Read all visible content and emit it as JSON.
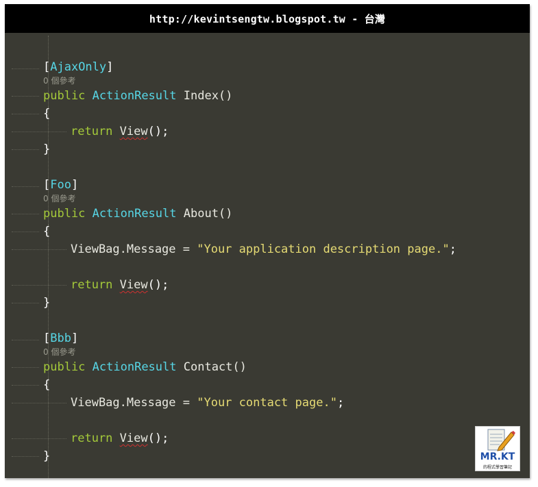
{
  "banner": {
    "text": "http://kevintsengtw.blogspot.tw - 台灣"
  },
  "code": {
    "ref_label": "0 個參考",
    "a1": {
      "open": "[",
      "name": "AjaxOnly",
      "close": "]"
    },
    "m1": {
      "kw": "public",
      "type": "ActionResult",
      "name": "Index()"
    },
    "brace_open": "{",
    "brace_close": "}",
    "ret": {
      "kw": "return",
      "call": "View",
      "tail": "();"
    },
    "a2": {
      "open": "[",
      "name": "Foo",
      "close": "]"
    },
    "m2": {
      "kw": "public",
      "type": "ActionResult",
      "name": "About()"
    },
    "msg_prefix": "ViewBag.Message = ",
    "str_about": "\"Your application description page.\"",
    "semi": ";",
    "a3": {
      "open": "[",
      "name": "Bbb",
      "close": "]"
    },
    "m3": {
      "kw": "public",
      "type": "ActionResult",
      "name": "Contact()"
    },
    "str_contact": "\"Your contact page.\""
  },
  "logo": {
    "title": "MR.KT",
    "subtitle": "的程式學習筆記"
  },
  "colors": {
    "background": "#3a3a33",
    "keyword": "#a4c93a",
    "type": "#57d6e6",
    "string": "#e6db74",
    "banner": "#000000"
  }
}
